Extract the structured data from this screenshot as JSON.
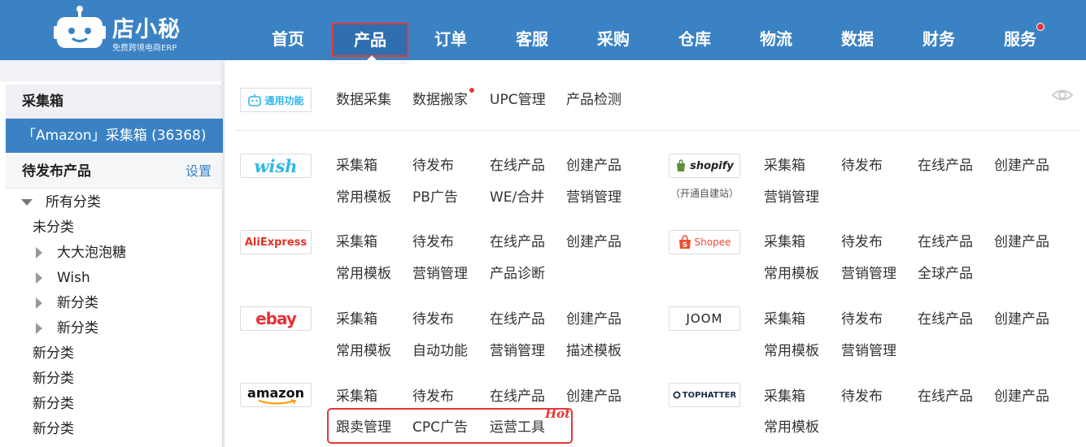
{
  "app": {
    "logo_name": "店小秘",
    "logo_tagline": "免费跨境电商ERP"
  },
  "nav": {
    "items": [
      {
        "label": "首页",
        "name": "nav-home"
      },
      {
        "label": "产品",
        "name": "nav-products",
        "active": true
      },
      {
        "label": "订单",
        "name": "nav-orders"
      },
      {
        "label": "客服",
        "name": "nav-customer-service"
      },
      {
        "label": "采购",
        "name": "nav-purchasing"
      },
      {
        "label": "仓库",
        "name": "nav-warehouse"
      },
      {
        "label": "物流",
        "name": "nav-logistics"
      },
      {
        "label": "数据",
        "name": "nav-data"
      },
      {
        "label": "财务",
        "name": "nav-finance"
      },
      {
        "label": "服务",
        "name": "nav-services",
        "dot": true
      }
    ]
  },
  "sidebar": {
    "section1_title": "采集箱",
    "selected_item": "「Amazon」采集箱 (36368)",
    "section2_title": "待发布产品",
    "settings_label": "设置",
    "tree": {
      "root": "所有分类",
      "items": [
        "未分类",
        "大大泡泡糖",
        "Wish",
        "新分类",
        "新分类",
        "新分类",
        "新分类",
        "新分类",
        "新分类"
      ]
    }
  },
  "panel": {
    "general": {
      "badge": "通用功能",
      "links": [
        "数据采集",
        "数据搬家",
        "UPC管理",
        "产品检测"
      ]
    },
    "platforms": [
      {
        "name": "wish",
        "logo": "wish",
        "color": "#2fb7ec",
        "rows": [
          [
            "采集箱",
            "待发布",
            "在线产品",
            "创建产品"
          ],
          [
            "常用模板",
            "PB广告",
            "WE/合并",
            "营销管理"
          ]
        ]
      },
      {
        "name": "shopify",
        "logo": "shopify",
        "color": "#5e8e3e",
        "sub": "（开通自建站）",
        "rows": [
          [
            "采集箱",
            "待发布",
            "在线产品",
            "创建产品"
          ],
          [
            "营销管理"
          ]
        ]
      },
      {
        "name": "aliexpress",
        "logo": "AliExpress",
        "color": "#e43225",
        "rows": [
          [
            "采集箱",
            "待发布",
            "在线产品",
            "创建产品"
          ],
          [
            "常用模板",
            "营销管理",
            "产品诊断"
          ]
        ]
      },
      {
        "name": "shopee",
        "logo": "Shopee",
        "color": "#ee4d2d",
        "rows": [
          [
            "采集箱",
            "待发布",
            "在线产品",
            "创建产品"
          ],
          [
            "常用模板",
            "营销管理",
            "全球产品"
          ]
        ]
      },
      {
        "name": "ebay",
        "logo": "ebay",
        "color": "#e53238",
        "rows": [
          [
            "采集箱",
            "待发布",
            "在线产品",
            "创建产品"
          ],
          [
            "常用模板",
            "自动功能",
            "营销管理",
            "描述模板"
          ]
        ]
      },
      {
        "name": "joom",
        "logo": "JOOM",
        "color": "#222222",
        "rows": [
          [
            "采集箱",
            "待发布",
            "在线产品",
            "创建产品"
          ],
          [
            "常用模板",
            "营销管理"
          ]
        ]
      },
      {
        "name": "amazon",
        "logo": "amazon",
        "color": "#111111",
        "rows": [
          [
            "采集箱",
            "待发布",
            "在线产品",
            "创建产品"
          ],
          [
            "跟卖管理",
            "CPC广告",
            "运营工具"
          ]
        ]
      },
      {
        "name": "tophatter",
        "logo": "TOPHATTER",
        "color": "#1a2a4a",
        "rows": [
          [
            "采集箱",
            "待发布",
            "在线产品",
            "创建产品"
          ],
          [
            "常用模板"
          ]
        ]
      }
    ],
    "hot_label": "Hot"
  },
  "colors": {
    "brand": "#3b82c4",
    "alert": "#e53935"
  }
}
